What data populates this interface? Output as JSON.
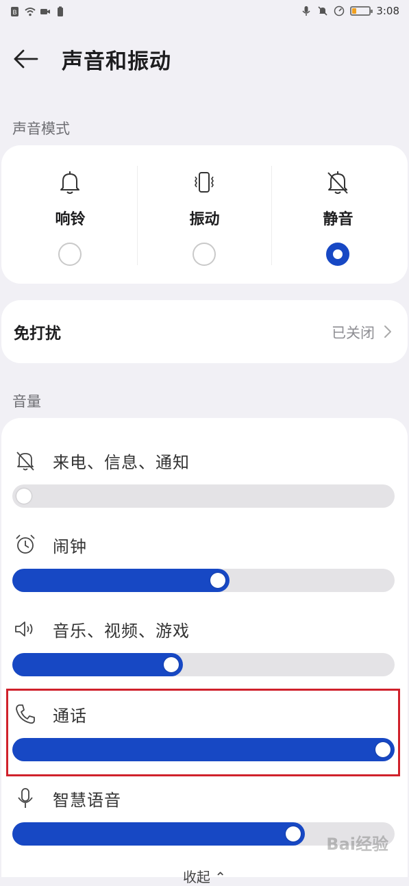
{
  "status_bar": {
    "left_icons": [
      "sim-icon",
      "wifi-icon",
      "video-icon",
      "battery-small-icon"
    ],
    "right_icons": [
      "mic-icon",
      "mute-icon",
      "speed-icon",
      "battery-icon"
    ],
    "time": "3:08",
    "battery_level": 0.25,
    "battery_color": "#f0a020"
  },
  "header": {
    "title": "声音和振动"
  },
  "sound_mode": {
    "section_label": "声音模式",
    "modes": [
      {
        "label": "响铃",
        "icon": "bell-icon",
        "selected": false
      },
      {
        "label": "振动",
        "icon": "vibrate-icon",
        "selected": false
      },
      {
        "label": "静音",
        "icon": "bell-off-icon",
        "selected": true
      }
    ],
    "accent": "#1748c4"
  },
  "dnd": {
    "label": "免打扰",
    "status": "已关闭"
  },
  "volume": {
    "section_label": "音量",
    "rows": [
      {
        "name": "来电、信息、通知",
        "icon": "bell-off-icon",
        "level": 0.0
      },
      {
        "name": "闹钟",
        "icon": "alarm-icon",
        "level": 0.54
      },
      {
        "name": "音乐、视频、游戏",
        "icon": "speaker-icon",
        "level": 0.41
      },
      {
        "name": "通话",
        "icon": "phone-icon",
        "level": 1.0
      },
      {
        "name": "智慧语音",
        "icon": "mic-icon",
        "level": 0.75
      }
    ]
  },
  "collapse_label": "收起 ⌃",
  "watermark": "Bai经验"
}
